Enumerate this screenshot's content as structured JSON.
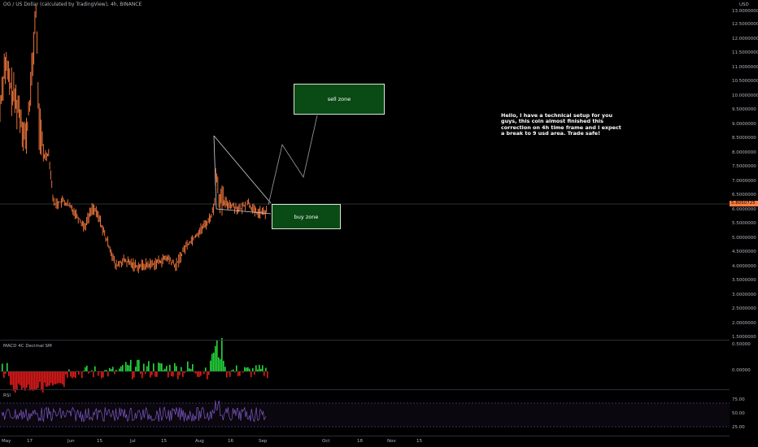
{
  "header": {
    "symbol_title": "OG / US Dollar (calculated by TradingView), 4h, BINANCE"
  },
  "price_scale": {
    "currency": "USD",
    "ticks": [
      "13.0000000",
      "12.5000000",
      "12.0000000",
      "11.5000000",
      "11.0000000",
      "10.5000000",
      "10.0000000",
      "9.5000000",
      "9.0000000",
      "8.5000000",
      "8.0000000",
      "7.5000000",
      "7.0000000",
      "6.5000000",
      "6.0000000",
      "5.5000000",
      "5.0000000",
      "4.5000000",
      "4.0000000",
      "3.5000000",
      "3.0000000",
      "2.5000000",
      "2.0000000",
      "1.5000000"
    ],
    "last_price": "5.8050725"
  },
  "time_axis": {
    "labels": [
      "May",
      "17",
      "Jun",
      "15",
      "Jul",
      "15",
      "Aug",
      "16",
      "Sep",
      "Oct",
      "18",
      "Nov",
      "15"
    ]
  },
  "annotations": {
    "sell_zone": "sell zone",
    "buy_zone": "buy zone",
    "note": "Hello, I have a technical setup for you guys, this coin almost finished this correction on 4h time frame and I expect a break to 9 usd area. Trade safe!"
  },
  "macd": {
    "label": "MACD 4C Decimal SM",
    "ticks": [
      "0.50000",
      "0.00000"
    ]
  },
  "rsi": {
    "label": "RSI",
    "ticks": [
      "75.00",
      "50.00",
      "25.00"
    ]
  },
  "colors": {
    "candle": "#ff7e40",
    "zone_fill": "#0a4a14",
    "macd_up": "#26d93b",
    "macd_down": "#e31b1b",
    "rsi_line": "#7e57c2"
  }
}
